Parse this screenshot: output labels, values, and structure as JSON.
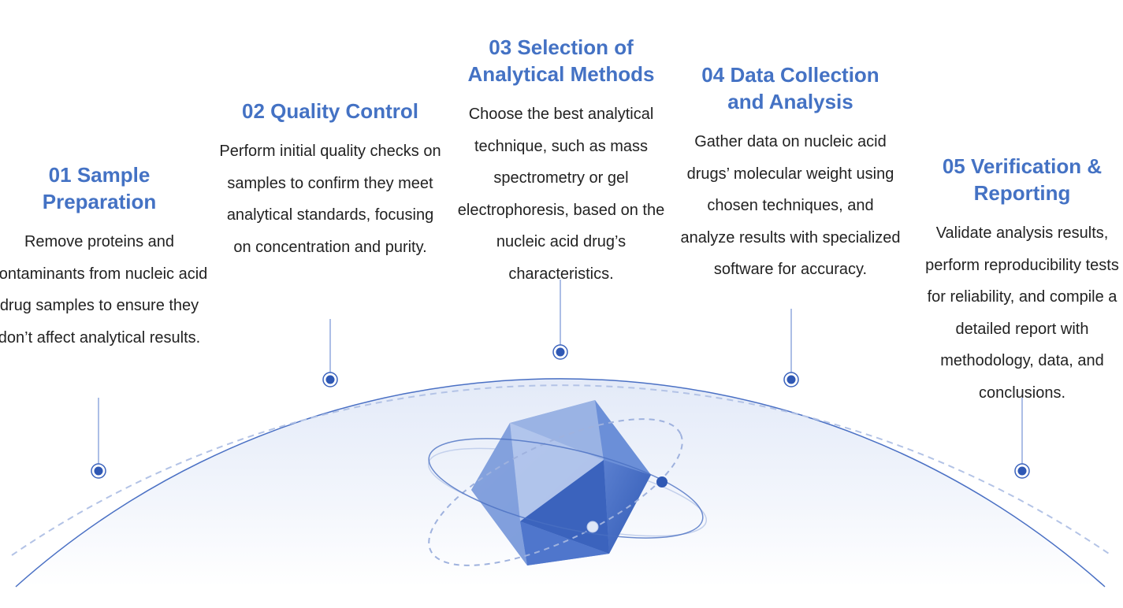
{
  "colors": {
    "accent": "#4472c4",
    "text": "#222222",
    "dome": "#e8eef9"
  },
  "steps": [
    {
      "title": "01 Sample Preparation",
      "body": "Remove proteins and contaminants from nucleic acid drug samples to ensure they don’t affect analytical results."
    },
    {
      "title": "02 Quality Control",
      "body": "Perform initial quality checks on samples to confirm they meet analytical standards, focusing on concentration and purity."
    },
    {
      "title": "03 Selection of Analytical Methods",
      "body": "Choose the best analytical technique, such as mass spectrometry or gel electrophoresis, based on the nucleic acid drug’s characteristics."
    },
    {
      "title": "04 Data Collection and Analysis",
      "body": "Gather data on nucleic acid drugs’ molecular weight using chosen techniques, and analyze results with specialized software for accuracy."
    },
    {
      "title": "05 Verification & Reporting",
      "body": "Validate analysis results, perform reproducibility tests for reliability, and compile a detailed report with methodology, data, and conclusions."
    }
  ],
  "icons": {
    "center": "icosahedron-atom-icon",
    "marker": "timeline-node-icon"
  }
}
